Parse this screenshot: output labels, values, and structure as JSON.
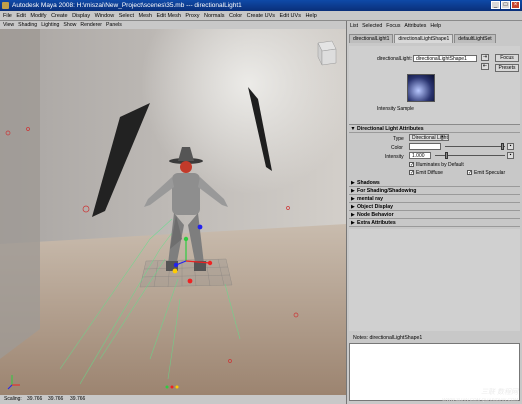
{
  "window": {
    "title": "Autodesk Maya 2008: H:\\miszai\\New_Project\\scenes\\35.mb --- directionalLight1",
    "minimize": "_",
    "maximize": "□",
    "close": "×"
  },
  "menubar": [
    "File",
    "Edit",
    "Modify",
    "Create",
    "Display",
    "Window",
    "Select",
    "Mesh",
    "Edit Mesh",
    "Proxy",
    "Normals",
    "Color",
    "Create UVs",
    "Edit UVs",
    "Help"
  ],
  "viewport": {
    "menu": [
      "View",
      "Shading",
      "Lighting",
      "Show",
      "Renderer",
      "Panels"
    ],
    "status": {
      "scaling_label": "Scaling:",
      "v1": "39.766",
      "v2": "39.766",
      "v3": "39.766"
    }
  },
  "attribute_editor": {
    "menu": [
      "List",
      "Selected",
      "Focus",
      "Attributes",
      "Help"
    ],
    "tabs": [
      "directionalLight1",
      "directionalLightShape1",
      "defaultLightSet"
    ],
    "active_tab": 1,
    "node_label": "directionalLight:",
    "node_value": "directionalLightShape1",
    "focus_button": "Focus",
    "presets_button": "Presets",
    "intensity_sample_label": "Intensity Sample",
    "sections": {
      "directional_light_attributes": "Directional Light Attributes",
      "shadows": "Shadows",
      "for_shading": "For Shading/Shadowing",
      "mental_ray": "mental ray",
      "object_display": "Object Display",
      "node_behavior": "Node Behavior",
      "extra_attributes": "Extra Attributes"
    },
    "type_label": "Type",
    "type_value": "Directional Light",
    "color_label": "Color",
    "intensity_label": "Intensity",
    "intensity_value": "1.000",
    "illuminates_by_default": "Illuminates by Default",
    "emit_diffuse": "Emit Diffuse",
    "emit_specular": "Emit Specular",
    "notes_label": "Notes:",
    "notes_value": "directionalLightShape1"
  },
  "watermark": {
    "line1": "三联 数程网",
    "line2": "WWW.3LIAN.COM QUAXIDIAN.COM"
  },
  "colors": {
    "title_bar": "#0f4aa8",
    "ui_gray": "#c8c8c8",
    "character": "#8e8e8e",
    "hat_red_face": "#c23a2a"
  }
}
